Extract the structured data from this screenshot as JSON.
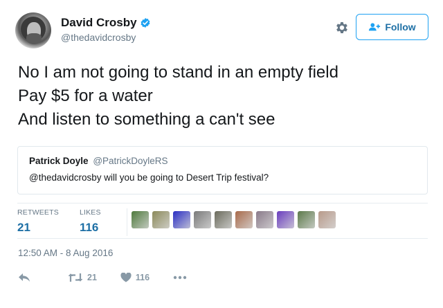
{
  "author": {
    "display_name": "David Crosby",
    "handle": "@thedavidcrosby",
    "verified": true
  },
  "header": {
    "follow_label": "Follow",
    "settings_icon": "gear-icon"
  },
  "tweet": {
    "lines": [
      "No I am not going to stand in an empty field",
      "Pay $5 for a water",
      "And listen to something a can't see"
    ]
  },
  "quoted_tweet": {
    "name": "Patrick Doyle",
    "handle": "@PatrickDoyleRS",
    "text": "@thedavidcrosby will you be going to Desert Trip festival?"
  },
  "stats": {
    "retweets_label": "RETWEETS",
    "retweets_value": "21",
    "likes_label": "LIKES",
    "likes_value": "116",
    "liker_avatar_colors": [
      "#4e7a3c",
      "#8c8a5a",
      "#2a2ec4",
      "#7a7a7a",
      "#6b6b5c",
      "#a86a4a",
      "#8a7a8a",
      "#6a3dbf",
      "#5c7a4a",
      "#b89a8a"
    ]
  },
  "timestamp": "12:50 AM - 8 Aug 2016",
  "actions": {
    "reply_icon": "reply-icon",
    "retweet_icon": "retweet-icon",
    "retweet_count": "21",
    "like_icon": "heart-icon",
    "like_count": "116",
    "more_icon": "more-icon"
  },
  "colors": {
    "accent": "#1da1f2",
    "link": "#1d6fa5",
    "muted": "#657786",
    "icon": "#8899a6"
  }
}
